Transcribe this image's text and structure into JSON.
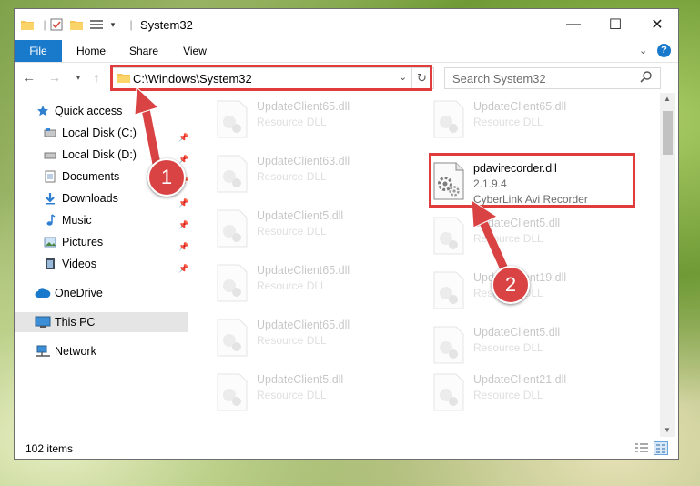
{
  "window": {
    "title": "System32",
    "controls": {
      "minimize": "—",
      "maximize": "☐",
      "close": "✕"
    }
  },
  "ribbon": {
    "tabs": [
      {
        "label": "File"
      },
      {
        "label": "Home"
      },
      {
        "label": "Share"
      },
      {
        "label": "View"
      }
    ],
    "help": "?"
  },
  "addressbar": {
    "path": "C:\\Windows\\System32",
    "search_placeholder": "Search System32"
  },
  "nav": {
    "quick_access": "Quick access",
    "items": [
      {
        "label": "Local Disk (C:)"
      },
      {
        "label": "Local Disk (D:)"
      },
      {
        "label": "Documents"
      },
      {
        "label": "Downloads"
      },
      {
        "label": "Music"
      },
      {
        "label": "Pictures"
      },
      {
        "label": "Videos"
      }
    ],
    "onedrive": "OneDrive",
    "thispc": "This PC",
    "network": "Network"
  },
  "files": {
    "highlight": {
      "name": "pdavirecorder.dll",
      "version": "2.1.9.4",
      "description": "CyberLink Avi Recorder"
    },
    "left_column": [
      {
        "name": "UpdateClient65.dll",
        "type": "Resource DLL"
      },
      {
        "name": "UpdateClient63.dll",
        "type": "Resource DLL"
      },
      {
        "name": "UpdateClient5.dll",
        "type": "Resource DLL"
      },
      {
        "name": "UpdateClient65.dll",
        "type": "Resource DLL"
      },
      {
        "name": "UpdateClient65.dll",
        "type": "Resource DLL"
      },
      {
        "name": "UpdateClient5.dll",
        "type": "Resource DLL"
      }
    ],
    "right_column": [
      {
        "name": "UpdateClient65.dll",
        "type": "Resource DLL"
      },
      {
        "name": "UpdateClient5.dll",
        "type": "Resource DLL"
      },
      {
        "name": "UpdateClient19.dll",
        "type": "Resource DLL"
      },
      {
        "name": "UpdateClient5.dll",
        "type": "Resource DLL"
      },
      {
        "name": "UpdateClient21.dll",
        "type": "Resource DLL"
      }
    ]
  },
  "status": {
    "count": "102 items"
  },
  "annotations": {
    "badge1": "1",
    "badge2": "2"
  },
  "colors": {
    "accent": "#1979ca",
    "highlight": "#e03c3c",
    "selected_nav": "#cce8ff"
  }
}
